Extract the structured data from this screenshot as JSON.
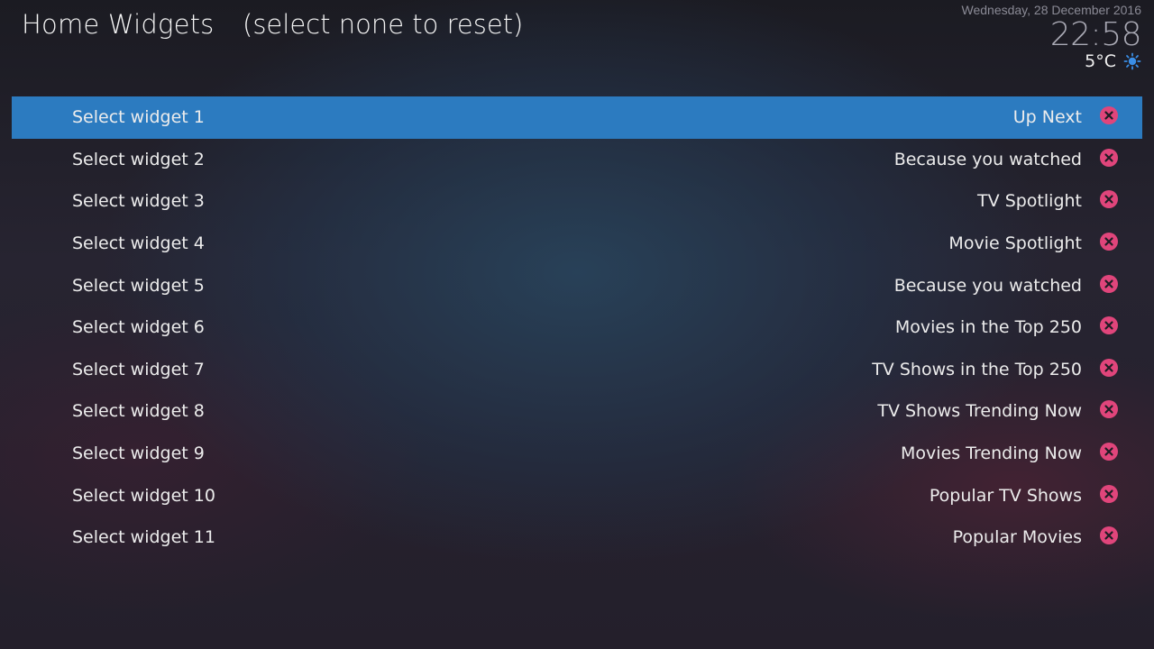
{
  "header": {
    "title": "Home Widgets",
    "subtitle": "(select none to reset)"
  },
  "info": {
    "date": "Wednesday, 28 December 2016",
    "time": "22:58",
    "temperature": "5°C",
    "weather_icon": "sun-icon"
  },
  "colors": {
    "selection": "#2c7bc0",
    "remove_icon": "#e0457b",
    "weather_icon": "#3a8ee6"
  },
  "widgets": [
    {
      "label": "Select widget 1",
      "value": "Up Next",
      "selected": true
    },
    {
      "label": "Select widget 2",
      "value": "Because you watched",
      "selected": false
    },
    {
      "label": "Select widget 3",
      "value": "TV Spotlight",
      "selected": false
    },
    {
      "label": "Select widget 4",
      "value": "Movie Spotlight",
      "selected": false
    },
    {
      "label": "Select widget 5",
      "value": "Because you watched",
      "selected": false
    },
    {
      "label": "Select widget 6",
      "value": "Movies in the Top 250",
      "selected": false
    },
    {
      "label": "Select widget 7",
      "value": "TV Shows in the Top 250",
      "selected": false
    },
    {
      "label": "Select widget 8",
      "value": "TV Shows Trending Now",
      "selected": false
    },
    {
      "label": "Select widget 9",
      "value": "Movies Trending Now",
      "selected": false
    },
    {
      "label": "Select widget 10",
      "value": "Popular TV Shows",
      "selected": false
    },
    {
      "label": "Select widget 11",
      "value": "Popular Movies",
      "selected": false
    }
  ]
}
